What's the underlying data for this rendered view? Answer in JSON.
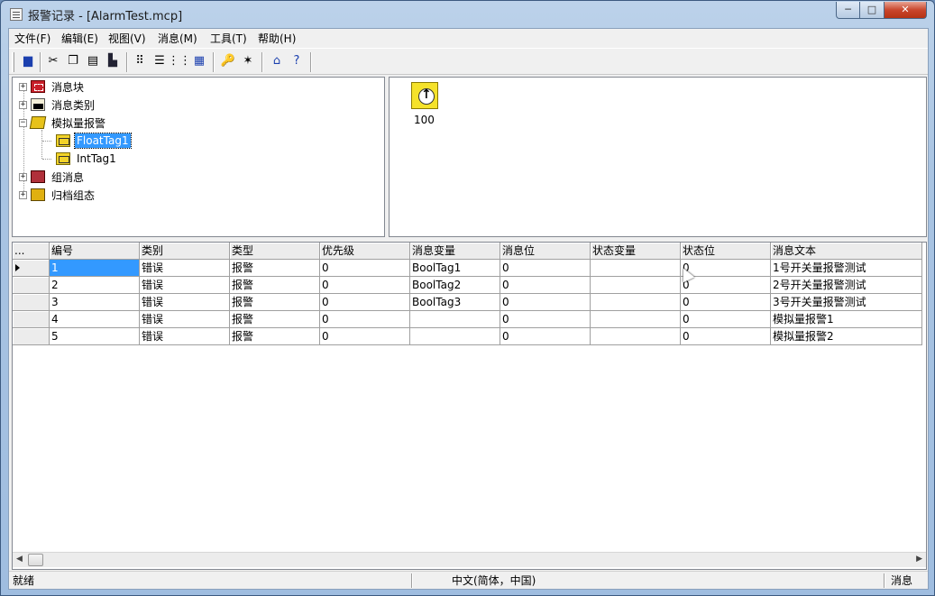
{
  "window": {
    "title": "报警记录 - [AlarmTest.mcp]",
    "minimize": "─",
    "maximize": "□",
    "close": "✕"
  },
  "menu": [
    {
      "label": "文件(F)"
    },
    {
      "label": "编辑(E)"
    },
    {
      "label": "视图(V)"
    },
    {
      "label": "消息(M)"
    },
    {
      "label": "工具(T)"
    },
    {
      "label": "帮助(H)"
    }
  ],
  "toolbar": {
    "buttons": [
      "save-icon",
      "cut-icon",
      "copy-icon",
      "paste-icon",
      "print-icon",
      "small-icons-icon",
      "list-icon",
      "details-icon",
      "table-icon",
      "properties-icon",
      "wizard-icon",
      "about-icon",
      "help-icon"
    ]
  },
  "tree": {
    "nodes": [
      {
        "label": "消息块",
        "expander": "+"
      },
      {
        "label": "消息类别",
        "expander": "+"
      },
      {
        "label": "模拟量报警",
        "expander": "−"
      },
      {
        "label": "FloatTag1"
      },
      {
        "label": "IntTag1"
      },
      {
        "label": "组消息",
        "expander": "+"
      },
      {
        "label": "归档组态",
        "expander": "+"
      }
    ]
  },
  "icon_view": {
    "item_label": "100"
  },
  "grid": {
    "corner": "...",
    "columns": [
      "编号",
      "类别",
      "类型",
      "优先级",
      "消息变量",
      "消息位",
      "状态变量",
      "状态位",
      "消息文本"
    ],
    "rows": [
      [
        "1",
        "错误",
        "报警",
        "0",
        "BoolTag1",
        "0",
        "",
        "0",
        "1号开关量报警测试"
      ],
      [
        "2",
        "错误",
        "报警",
        "0",
        "BoolTag2",
        "0",
        "",
        "0",
        "2号开关量报警测试"
      ],
      [
        "3",
        "错误",
        "报警",
        "0",
        "BoolTag3",
        "0",
        "",
        "0",
        "3号开关量报警测试"
      ],
      [
        "4",
        "错误",
        "报警",
        "0",
        "",
        "0",
        "",
        "0",
        "模拟量报警1"
      ],
      [
        "5",
        "错误",
        "报警",
        "0",
        "",
        "0",
        "",
        "0",
        "模拟量报警2"
      ]
    ]
  },
  "statusbar": {
    "left": "就绪",
    "middle": "中文(简体，中国)",
    "right": "消息"
  }
}
